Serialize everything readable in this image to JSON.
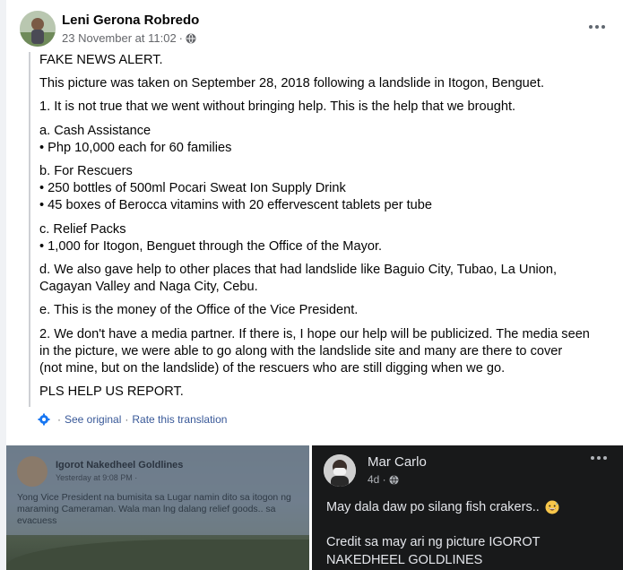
{
  "post": {
    "author": "Leni Gerona Robredo",
    "timestamp": "23 November at 11:02",
    "dot": "·",
    "paragraphs": [
      [
        "FAKE NEWS ALERT."
      ],
      [
        "This picture was taken on September 28, 2018 following a landslide in Itogon, Benguet."
      ],
      [
        "1. It is not true that we went without bringing help. This is the help that we brought."
      ],
      [
        "a. Cash Assistance",
        "• Php 10,000 each for 60 families"
      ],
      [
        "b. For Rescuers",
        "• 250 bottles of 500ml Pocari Sweat Ion Supply Drink",
        "• 45 boxes of Berocca vitamins with 20 effervescent tablets per tube"
      ],
      [
        "c. Relief Packs",
        "• 1,000 for Itogon, Benguet  through the Office of the Mayor."
      ],
      [
        "d. We also gave help to other places that had landslide like Baguio City, Tubao, La Union,",
        "Cagayan Valley and Naga City, Cebu."
      ],
      [
        "e. This is the money of the Office of the Vice President."
      ],
      [
        "2. We don't have a media partner. If there is, I hope our help will be publicized. The media seen",
        "in the picture, we were able to go along with the landslide site and many are there to cover",
        "(not mine, but on the landslide) of the rescuers who are still digging when we go."
      ],
      [
        "PLS HELP US REPORT."
      ]
    ],
    "translation": {
      "see_original": "See original",
      "separator": "·",
      "rate": "Rate this translation"
    }
  },
  "left_image": {
    "name": "Igorot Nakedheel Goldlines",
    "time": "Yesterday at 9:08 PM ·",
    "text": "Yong Vice President na bumisita sa Lugar namin dito sa itogon ng maraming Cameraman. Wala man lng dalang relief goods.. sa evacuess"
  },
  "right_image": {
    "name": "Mar Carlo",
    "meta": "4d ·",
    "text1": "May dala daw po silang fish crakers..",
    "text2": "Credit sa may ari ng picture IGOROT NAKEDHEEL GOLDLINES"
  },
  "icons": {
    "globe": "globe-icon",
    "more": "more-icon",
    "translate": "translate-gear-icon",
    "emoji": "grinning-sweat-emoji"
  }
}
